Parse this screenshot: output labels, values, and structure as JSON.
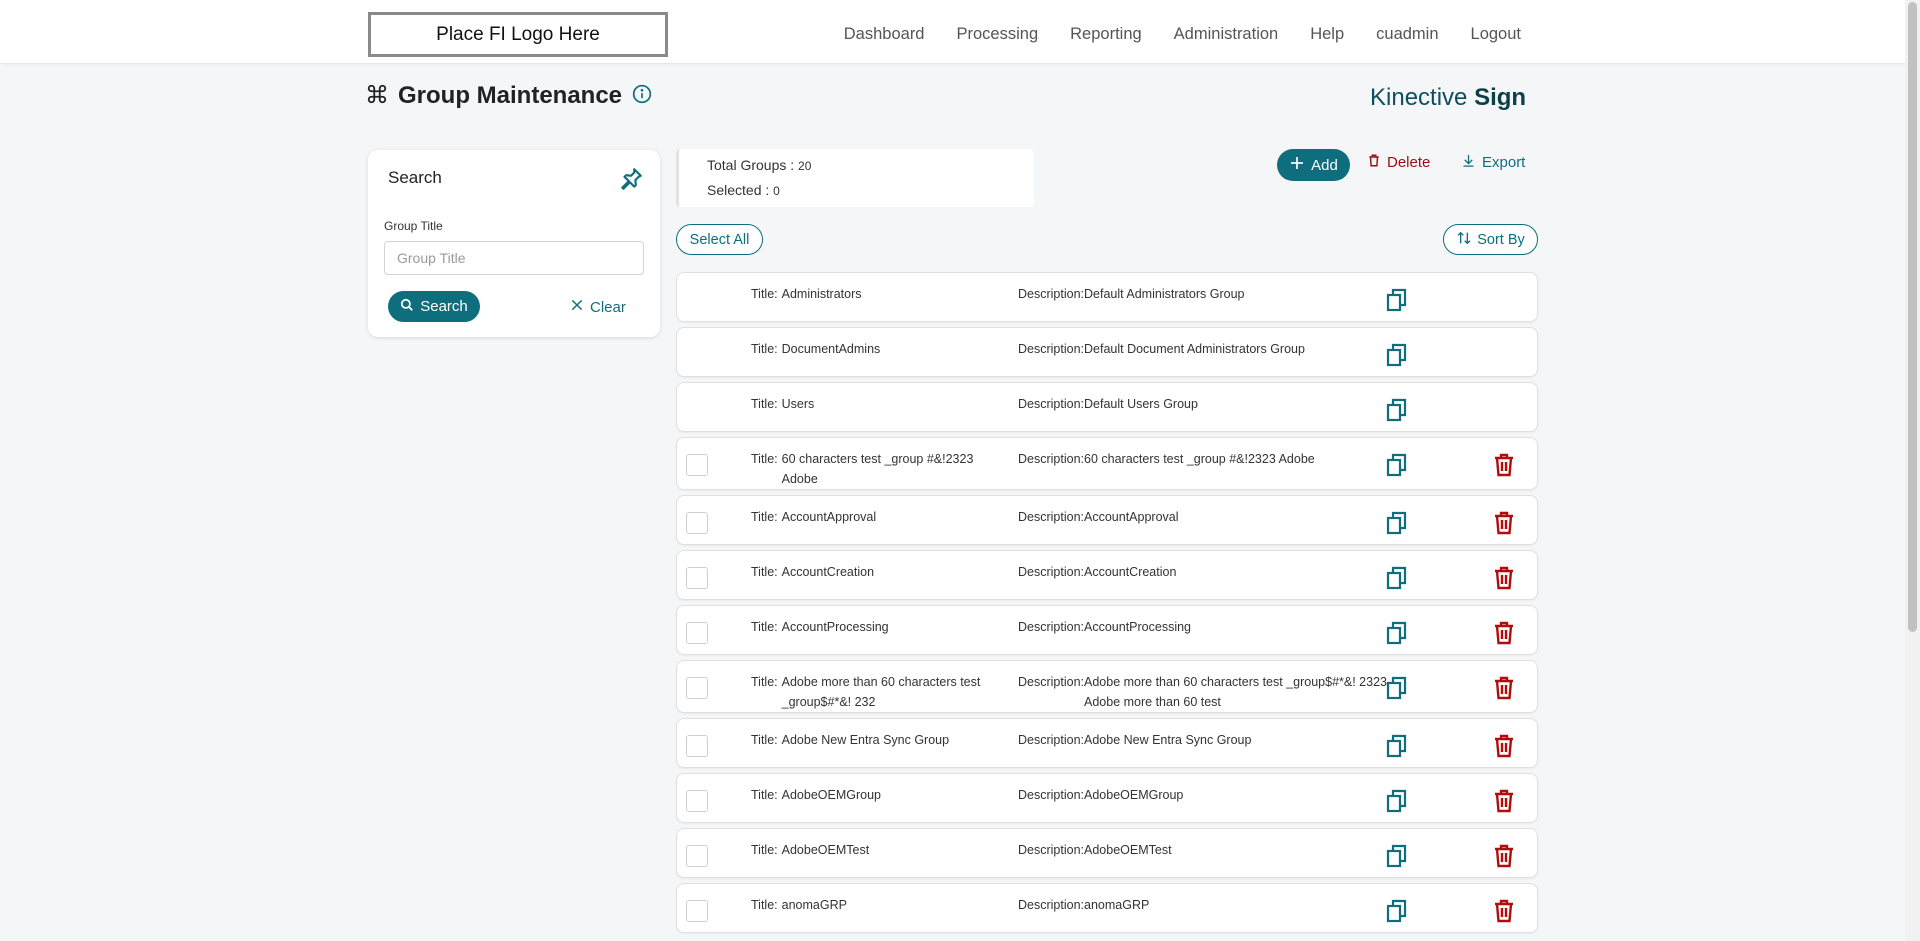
{
  "header": {
    "logo_text": "Place FI Logo Here",
    "nav": [
      "Dashboard",
      "Processing",
      "Reporting",
      "Administration",
      "Help",
      "cuadmin",
      "Logout"
    ]
  },
  "page": {
    "title": "Group Maintenance",
    "brand_light": "Kinective ",
    "brand_bold": "Sign"
  },
  "search": {
    "title": "Search",
    "field_label": "Group Title",
    "field_placeholder": "Group Title",
    "search_label": "Search",
    "clear_label": "Clear"
  },
  "summary": {
    "total_label": "Total Groups : ",
    "total_value": "20",
    "selected_label": "Selected : ",
    "selected_value": "0"
  },
  "actions": {
    "add_label": "Add",
    "delete_label": "Delete",
    "export_label": "Export",
    "select_all_label": "Select All",
    "sort_by_label": "Sort By"
  },
  "row_labels": {
    "title": "Title:",
    "description": "Description:"
  },
  "rows": [
    {
      "title": "Administrators",
      "description": "Default Administrators Group",
      "deletable": false
    },
    {
      "title": "DocumentAdmins",
      "description": "Default Document Administrators Group",
      "deletable": false
    },
    {
      "title": "Users",
      "description": "Default Users Group",
      "deletable": false
    },
    {
      "title": "60 characters test _group #&!2323 Adobe",
      "description": "60 characters test _group #&!2323 Adobe",
      "deletable": true
    },
    {
      "title": "AccountApproval",
      "description": "AccountApproval",
      "deletable": true
    },
    {
      "title": "AccountCreation",
      "description": "AccountCreation",
      "deletable": true
    },
    {
      "title": "AccountProcessing",
      "description": "AccountProcessing",
      "deletable": true
    },
    {
      "title": "Adobe more than 60 characters test _group$#*&! 232",
      "description": "Adobe more than 60 characters test _group$#*&! 2323 Adobe more than 60 test",
      "deletable": true
    },
    {
      "title": "Adobe New Entra Sync Group",
      "description": "Adobe New Entra Sync Group",
      "deletable": true
    },
    {
      "title": "AdobeOEMGroup",
      "description": "AdobeOEMGroup",
      "deletable": true
    },
    {
      "title": "AdobeOEMTest",
      "description": "AdobeOEMTest",
      "deletable": true
    },
    {
      "title": "anomaGRP",
      "description": "anomaGRP",
      "deletable": true
    }
  ],
  "colors": {
    "accent": "#0e6e7e",
    "danger": "#9a0f0f",
    "brand": "#0d4f5c"
  },
  "icons": {
    "title_icon": "command-icon",
    "info_icon": "info-icon",
    "pin_icon": "pin-icon",
    "search_icon": "search-icon",
    "clear_icon": "close-icon",
    "add_icon": "plus-icon",
    "delete_icon": "trash-icon",
    "export_icon": "download-icon",
    "sort_icon": "sort-icon",
    "copy_icon": "copy-icon"
  }
}
